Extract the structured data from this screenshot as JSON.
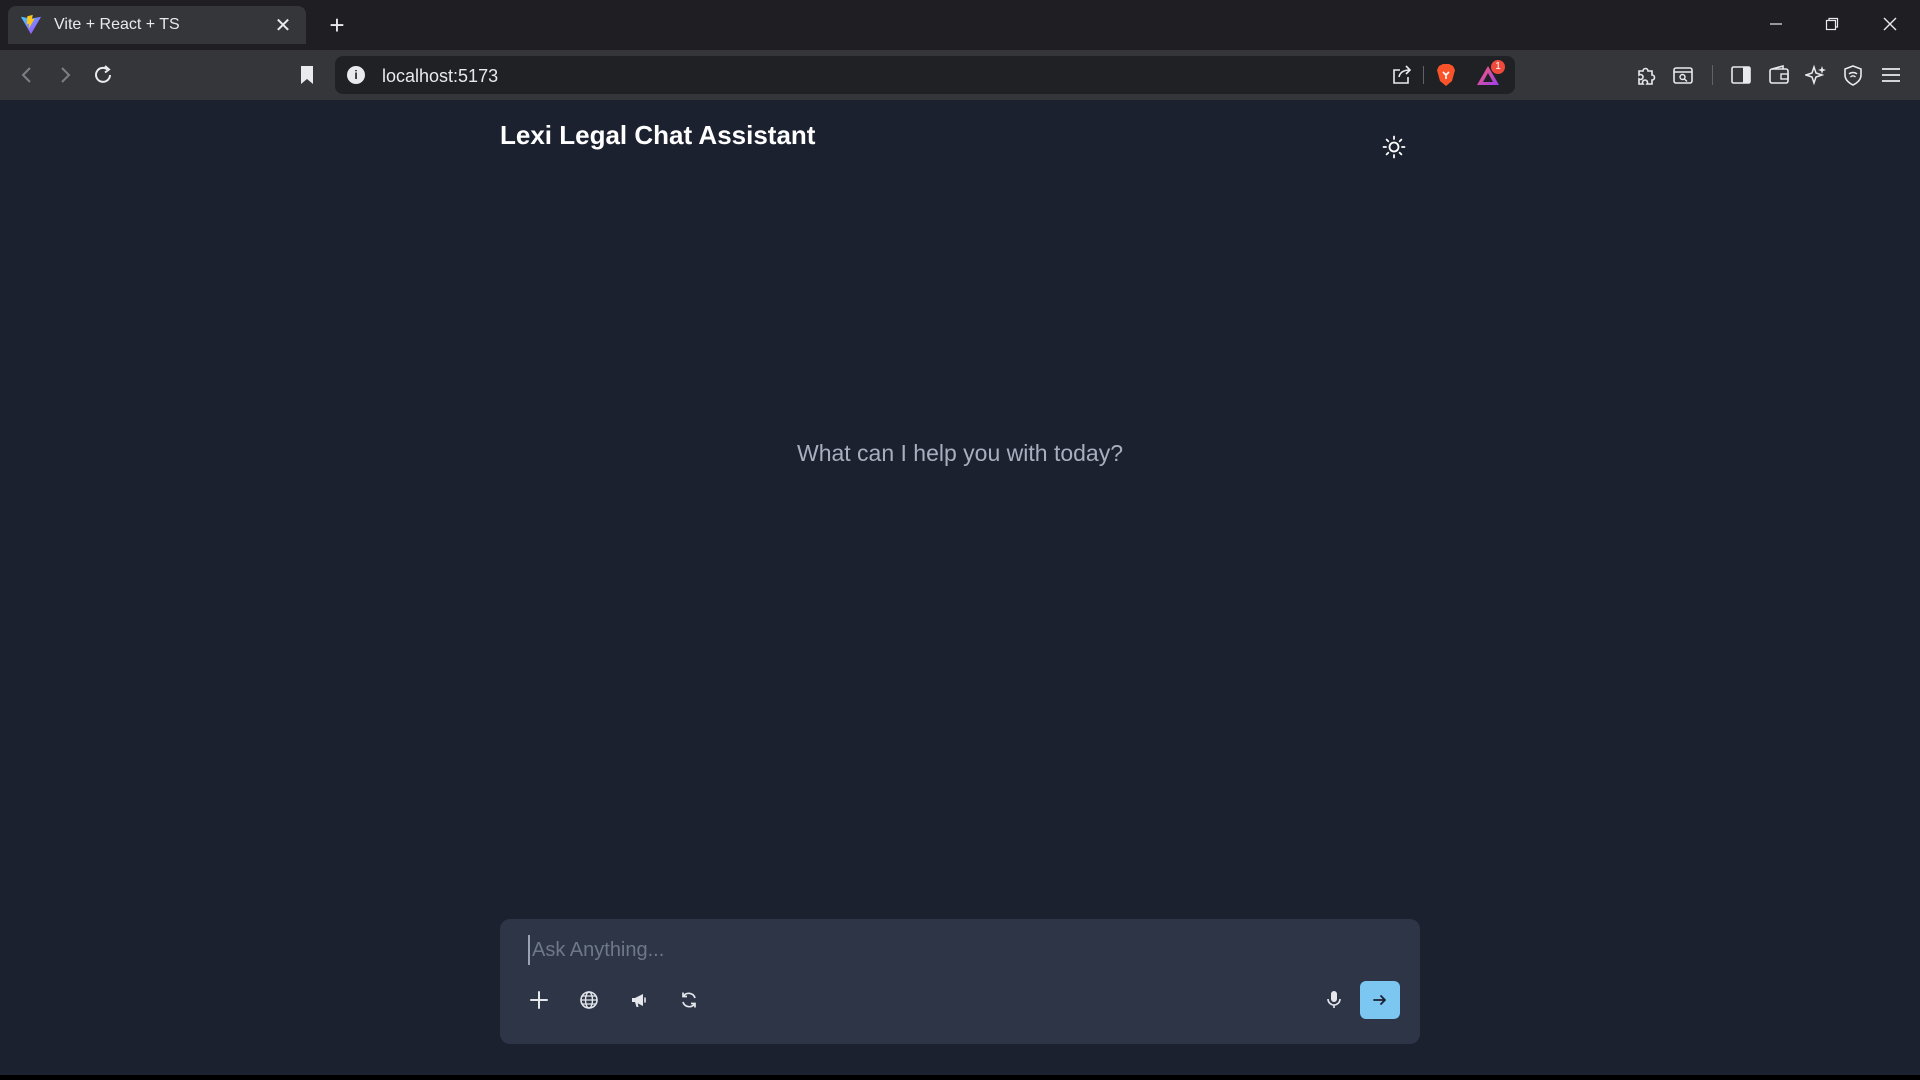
{
  "browser": {
    "tab_title": "Vite + React + TS",
    "url": "localhost:5173",
    "notification_count": "1"
  },
  "app": {
    "title": "Lexi Legal Chat Assistant",
    "welcome": "What can I help you with today?"
  },
  "composer": {
    "placeholder": "Ask Anything...",
    "value": ""
  },
  "icons": {
    "theme": "sun-icon",
    "tools": [
      "plus-icon",
      "globe-icon",
      "megaphone-icon",
      "refresh-icon"
    ],
    "mic": "mic-icon",
    "send": "arrow-right-icon"
  },
  "colors": {
    "page_bg": "#1c2130",
    "composer_bg": "#2d3547",
    "send_button": "#7cc6f2",
    "welcome_text": "#a7afbe"
  }
}
